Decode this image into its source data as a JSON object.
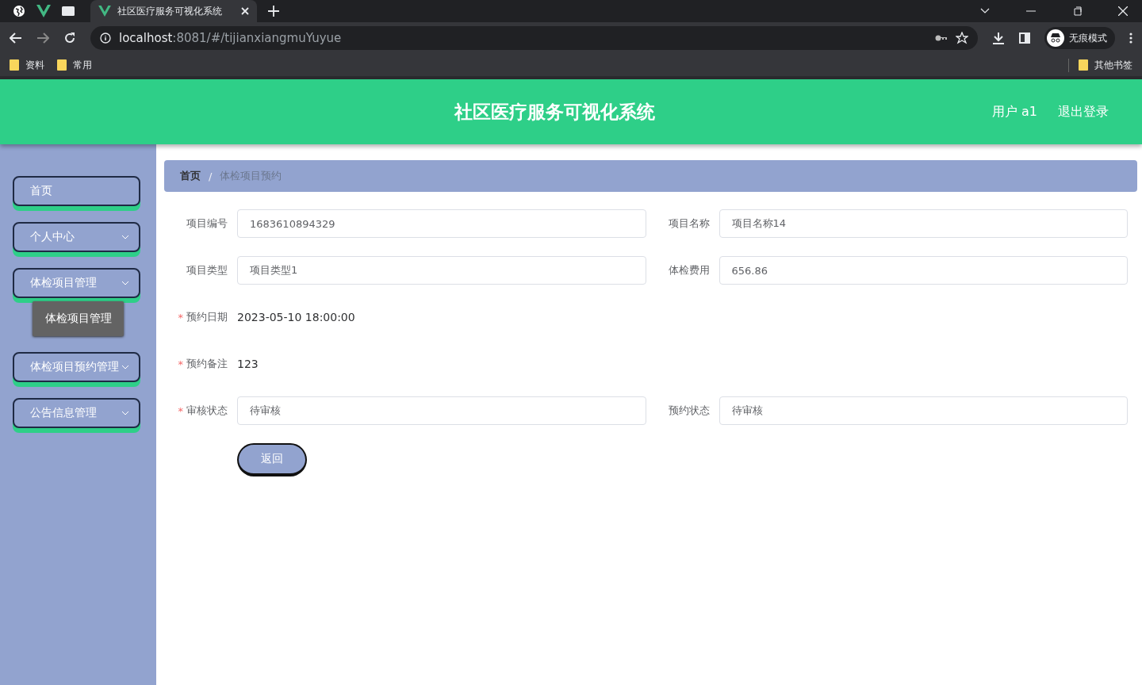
{
  "browser": {
    "tabs": [
      {
        "title": "社区医疗服务可视化系统",
        "selected": true
      }
    ],
    "address": {
      "host": "localhost",
      "path": ":8081/#/tijianxiangmuYuyue"
    },
    "profile": "无痕模式",
    "bookmarks": [
      "资料",
      "常用"
    ],
    "other_bookmarks": "其他书签"
  },
  "header": {
    "title": "社区医疗服务可视化系统",
    "user": "用户 a1",
    "logout": "退出登录"
  },
  "sidebar": {
    "items": [
      {
        "label": "首页",
        "expandable": false
      },
      {
        "label": "个人中心",
        "expandable": true
      },
      {
        "label": "体检项目管理",
        "expandable": true,
        "children": [
          {
            "label": "体检项目管理"
          }
        ]
      },
      {
        "label": "体检项目预约管理",
        "expandable": true
      },
      {
        "label": "公告信息管理",
        "expandable": true
      }
    ]
  },
  "breadcrumb": {
    "items": [
      "首页",
      "体检项目预约"
    ],
    "separator": "/"
  },
  "form": {
    "rows": [
      {
        "fields": [
          {
            "label": "项目编号",
            "value": "1683610894329",
            "kind": "input"
          },
          {
            "label": "项目名称",
            "value": "项目名称14",
            "kind": "input"
          }
        ]
      },
      {
        "fields": [
          {
            "label": "项目类型",
            "value": "项目类型1",
            "kind": "input"
          },
          {
            "label": "体检费用",
            "value": "656.86",
            "kind": "input"
          }
        ]
      },
      {
        "fields": [
          {
            "label": "预约日期",
            "value": "2023-05-10 18:00:00",
            "kind": "text",
            "required_mark": "*"
          }
        ]
      },
      {
        "fields": [
          {
            "label": "预约备注",
            "value": "123",
            "kind": "text",
            "required_mark": "*"
          }
        ]
      },
      {
        "fields": [
          {
            "label": "审核状态",
            "value": "待审核",
            "kind": "input",
            "required_mark": "*"
          },
          {
            "label": "预约状态",
            "value": "待审核",
            "kind": "input"
          }
        ]
      }
    ],
    "back_button": "返回"
  }
}
